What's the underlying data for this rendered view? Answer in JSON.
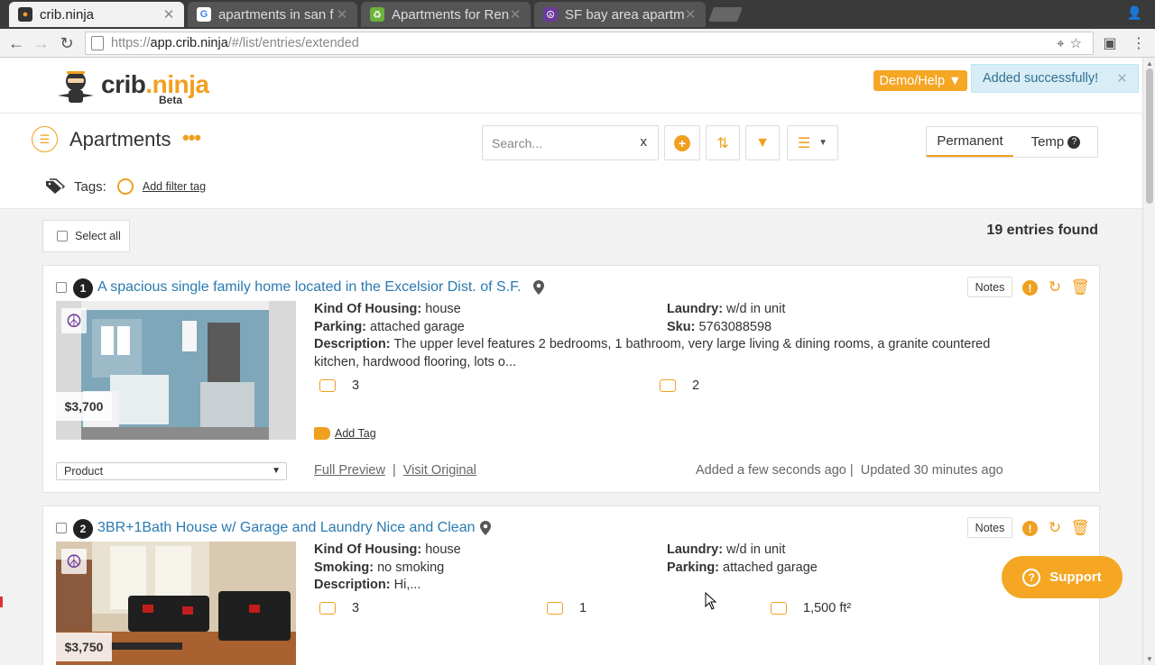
{
  "browser": {
    "tabs": [
      {
        "title": "crib.ninja",
        "active": true
      },
      {
        "title": "apartments in san f",
        "active": false
      },
      {
        "title": "Apartments for Ren",
        "active": false
      },
      {
        "title": "SF bay area apartm",
        "active": false
      }
    ],
    "url": {
      "scheme": "https://",
      "host": "app.crib.ninja",
      "path": "/#/list/entries/extended"
    }
  },
  "header": {
    "logo_word": "crib",
    "logo_suffix": ".ninja",
    "logo_beta": "Beta",
    "demo_label": "Demo/Help",
    "toast": "Added successfully!"
  },
  "toolbar": {
    "title": "Apartments",
    "search_placeholder": "Search...",
    "search_clear": "x",
    "tabs": [
      "Permanent",
      "Temp"
    ],
    "tags_label": "Tags:",
    "add_filter_tag": "Add filter tag"
  },
  "list": {
    "select_all": "Select all",
    "count": "19 entries found"
  },
  "entries": [
    {
      "num": "1",
      "title": "A spacious single family home located in the Excelsior Dist. of S.F.",
      "price": "$3,700",
      "notes": "Notes",
      "left": [
        {
          "k": "Kind Of Housing:",
          "v": " house"
        },
        {
          "k": "Parking:",
          "v": " attached garage"
        }
      ],
      "right": [
        {
          "k": "Laundry:",
          "v": " w/d in unit"
        },
        {
          "k": "Sku:",
          "v": " 5763088598"
        }
      ],
      "description_label": "Description:",
      "description": "  The upper level features 2 bedrooms, 1 bathroom, very large living & dining rooms, a granite countered kitchen, hardwood flooring, lots o...",
      "beds": "3",
      "baths": "2",
      "add_tag": "Add Tag",
      "product": "Product",
      "full_preview": "Full Preview",
      "visit_original": "Visit Original",
      "added": "Added a few seconds ago",
      "updated": "Updated 30 minutes ago"
    },
    {
      "num": "2",
      "title": "3BR+1Bath House w/ Garage and Laundry Nice and Clean",
      "price": "$3,750",
      "notes": "Notes",
      "left": [
        {
          "k": "Kind Of Housing:",
          "v": " house"
        },
        {
          "k": "Smoking:",
          "v": " no smoking"
        }
      ],
      "right": [
        {
          "k": "Laundry:",
          "v": " w/d in unit"
        },
        {
          "k": "Parking:",
          "v": " attached garage"
        }
      ],
      "description_label": "Description:",
      "description": "  Hi,...",
      "beds": "3",
      "baths": "1",
      "area": "1,500 ft²"
    }
  ],
  "support_label": "Support",
  "colors": {
    "accent": "#f5a623",
    "link": "#2a7ab0",
    "toast_bg": "#d9edf7"
  }
}
